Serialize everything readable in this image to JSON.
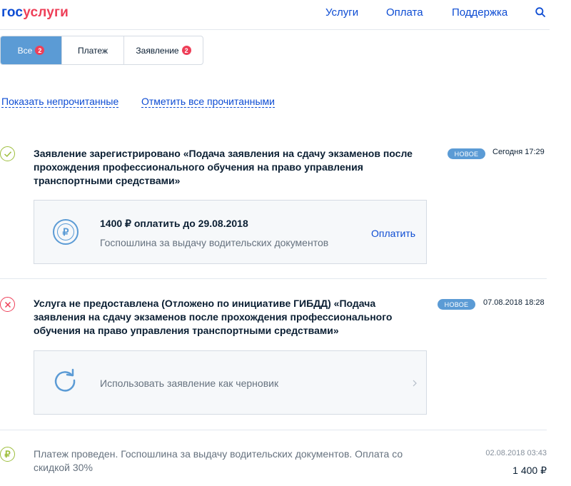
{
  "header": {
    "logo_part1": "гос",
    "logo_part2": "услуги",
    "nav": [
      "Услуги",
      "Оплата",
      "Поддержка"
    ]
  },
  "tabs": [
    {
      "label": "Все",
      "count": "2",
      "active": true
    },
    {
      "label": "Платеж",
      "count": "",
      "active": false
    },
    {
      "label": "Заявление",
      "count": "2",
      "active": false
    }
  ],
  "filters": {
    "show_unread": "Показать непрочитанные",
    "mark_all_read": "Отметить все прочитанными"
  },
  "items": [
    {
      "title": "Заявление зарегистрировано «Подача заявления на сдачу экзаменов после прохождения профессионального обучения на право управления транспортными средствами»",
      "badge": "НОВОЕ",
      "date": "Сегодня 17:29",
      "card": {
        "amount": "1400 ₽ оплатить до 29.08.2018",
        "description": "Госпошлина за выдачу водительских документов",
        "action": "Оплатить"
      }
    },
    {
      "title": "Услуга не предоставлена (Отложено по инициативе ГИБДД) «Подача заявления на сдачу экзаменов после прохождения профессионального обучения на право управления транспортными средствами»",
      "badge": "НОВОЕ",
      "date": "07.08.2018 18:28",
      "card": {
        "action": "Использовать заявление как черновик"
      }
    },
    {
      "text": "Платеж проведен. Госпошлина за выдачу водительских документов. Оплата со скидкой 30%",
      "date": "02.08.2018 03:43",
      "amount": "1 400 ₽"
    }
  ],
  "colors": {
    "accent": "#0d4cd3",
    "logo_red": "#ee3f58",
    "badge_blue": "#5b9bd5",
    "success": "#9dbe3c",
    "error": "#ee3f58"
  }
}
